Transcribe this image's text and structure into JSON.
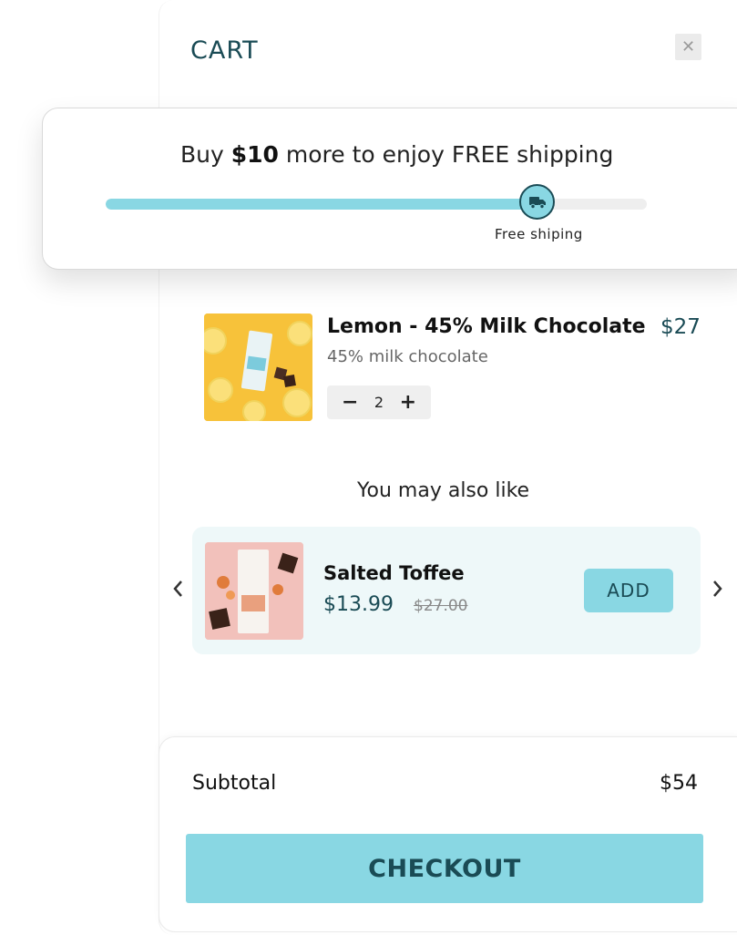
{
  "cart": {
    "title": "CART",
    "close_icon": "close-icon"
  },
  "shipping": {
    "prefix": "Buy ",
    "amount": "$10",
    "suffix": " more to enjoy FREE shipping",
    "progress": 0.8,
    "marker_icon": "truck-icon",
    "marker_label": "Free shiping"
  },
  "item": {
    "title": "Lemon - 45% Milk Chocolate",
    "price": "$27",
    "description": "45% milk chocolate",
    "quantity": "2",
    "minus_icon": "minus-icon",
    "plus_icon": "plus-icon"
  },
  "recommendations": {
    "heading": "You may also like",
    "product": {
      "title": "Salted Toffee",
      "price": "$13.99",
      "compare_price": "$27.00",
      "add_label": "ADD"
    },
    "prev_icon": "chevron-left-icon",
    "next_icon": "chevron-right-icon"
  },
  "footer": {
    "subtotal_label": "Subtotal",
    "subtotal_value": "$54",
    "checkout_label": "CHECKOUT"
  },
  "colors": {
    "accent": "#89d7e3",
    "dark_teal": "#1a4b55",
    "card_bg": "#eef8f9"
  }
}
